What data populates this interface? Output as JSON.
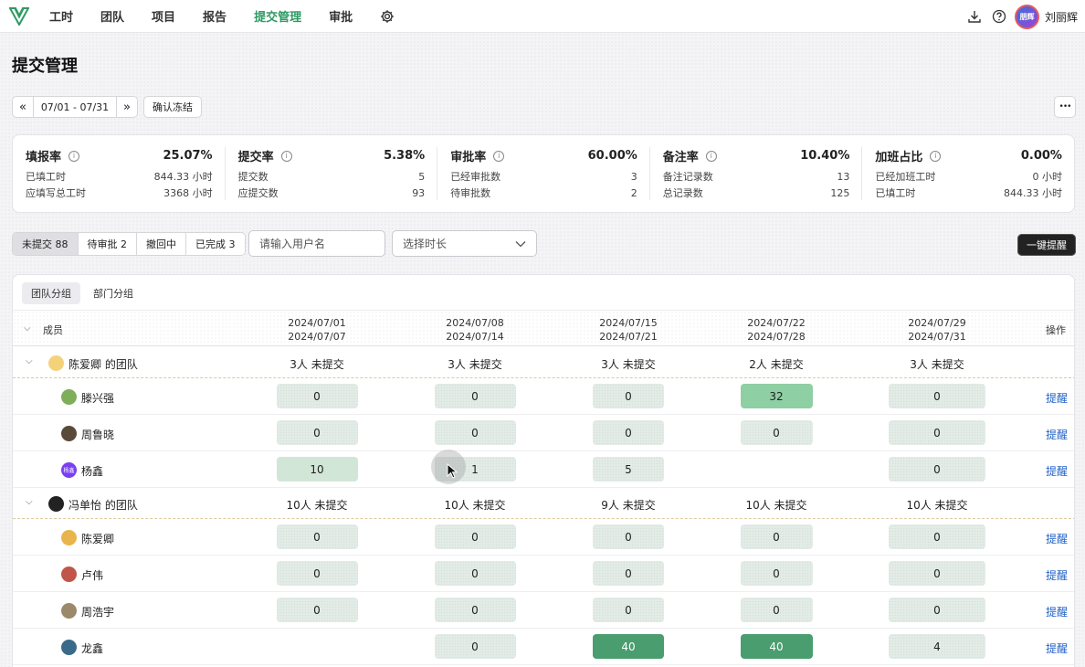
{
  "nav": {
    "items": [
      "工时",
      "团队",
      "项目",
      "报告",
      "提交管理",
      "审批"
    ],
    "active_index": 4,
    "active_color": "#2e9a63",
    "icons": [
      "gear-icon",
      "download-icon",
      "help-icon"
    ],
    "avatar_text": "朋辉",
    "username": "刘丽辉"
  },
  "page": {
    "title": "提交管理"
  },
  "toolbar": {
    "date_range": "07/01 - 07/31",
    "confirm_freeze": "确认冻结",
    "more": "•••"
  },
  "stats": [
    {
      "title": "填报率",
      "pct": "25.07%",
      "rows": [
        [
          "已填工时",
          "844.33 小时"
        ],
        [
          "应填写总工时",
          "3368 小时"
        ]
      ]
    },
    {
      "title": "提交率",
      "pct": "5.38%",
      "rows": [
        [
          "提交数",
          "5"
        ],
        [
          "应提交数",
          "93"
        ]
      ]
    },
    {
      "title": "审批率",
      "pct": "60.00%",
      "rows": [
        [
          "已经审批数",
          "3"
        ],
        [
          "待审批数",
          "2"
        ]
      ]
    },
    {
      "title": "备注率",
      "pct": "10.40%",
      "rows": [
        [
          "备注记录数",
          "13"
        ],
        [
          "总记录数",
          "125"
        ]
      ]
    },
    {
      "title": "加班占比",
      "pct": "0.00%",
      "rows": [
        [
          "已经加班工时",
          "0 小时"
        ],
        [
          "已填工时",
          "844.33 小时"
        ]
      ]
    }
  ],
  "filters": {
    "segments": [
      "未提交 88",
      "待审批 2",
      "撤回中",
      "已完成 3"
    ],
    "active_segment": 0,
    "search_placeholder": "请输入用户名",
    "duration_placeholder": "选择时长",
    "remind_all": "一键提醒"
  },
  "table": {
    "tabs": [
      "团队分组",
      "部门分组"
    ],
    "active_tab": 0,
    "member_header": "成员",
    "action_header": "操作",
    "weeks": [
      [
        "2024/07/01",
        "2024/07/07"
      ],
      [
        "2024/07/08",
        "2024/07/14"
      ],
      [
        "2024/07/15",
        "2024/07/21"
      ],
      [
        "2024/07/22",
        "2024/07/28"
      ],
      [
        "2024/07/29",
        "2024/07/31"
      ]
    ],
    "remind_label": "提醒",
    "groups": [
      {
        "name": "陈爱卿 的团队",
        "summary": [
          "3人 未提交",
          "3人 未提交",
          "3人 未提交",
          "2人 未提交",
          "3人 未提交"
        ],
        "members": [
          {
            "name": "滕兴强",
            "values": [
              "0",
              "0",
              "0",
              "32",
              "0"
            ],
            "levels": [
              "zero",
              "zero",
              "zero",
              "mid",
              "zero"
            ]
          },
          {
            "name": "周鲁晓",
            "values": [
              "0",
              "0",
              "0",
              "0",
              "0"
            ],
            "levels": [
              "zero",
              "zero",
              "zero",
              "zero",
              "zero"
            ]
          },
          {
            "name": "杨鑫",
            "avatar_text": "杨鑫",
            "values": [
              "10",
              "1",
              "5",
              "",
              "0"
            ],
            "levels": [
              "low",
              "zero",
              "zero",
              "none",
              "zero"
            ]
          }
        ]
      },
      {
        "name": "冯单怡 的团队",
        "summary": [
          "10人 未提交",
          "10人 未提交",
          "9人 未提交",
          "10人 未提交",
          "10人 未提交"
        ],
        "members": [
          {
            "name": "陈爱卿",
            "values": [
              "0",
              "0",
              "0",
              "0",
              "0"
            ],
            "levels": [
              "zero",
              "zero",
              "zero",
              "zero",
              "zero"
            ]
          },
          {
            "name": "卢伟",
            "values": [
              "0",
              "0",
              "0",
              "0",
              "0"
            ],
            "levels": [
              "zero",
              "zero",
              "zero",
              "zero",
              "zero"
            ]
          },
          {
            "name": "周浩宇",
            "values": [
              "0",
              "0",
              "0",
              "0",
              "0"
            ],
            "levels": [
              "zero",
              "zero",
              "zero",
              "zero",
              "zero"
            ]
          },
          {
            "name": "龙鑫",
            "values": [
              "",
              "0",
              "40",
              "40",
              "4"
            ],
            "levels": [
              "none",
              "zero",
              "high",
              "high",
              "zero"
            ]
          }
        ]
      }
    ]
  }
}
